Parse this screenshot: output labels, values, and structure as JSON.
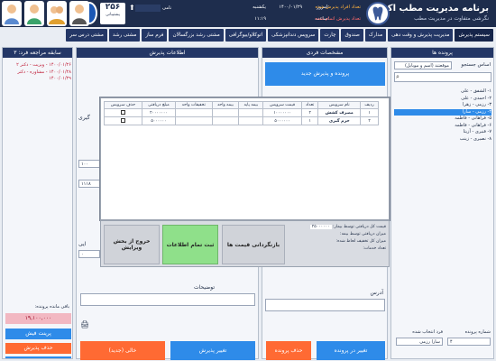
{
  "header": {
    "app_title": "برنامه مدیریت مطب اکسیر",
    "app_subtitle": "نگرشی متفاوت در مدیریت مطب",
    "today_label": "امروز:",
    "today_date": "۱۴۰۰/۰۱/۲۹",
    "weekday": "یکشنبه",
    "time_label": "ساعت:",
    "time_value": "۱۱:۱۹",
    "admitted_label": "تعداد افراد پذیرش شده",
    "admitted_done_label": "تعداد پذیرش اتمام شده",
    "user_label": "نامی",
    "support_number": "۲۵۶",
    "support_label": "پشتیبانی"
  },
  "nav": {
    "items": [
      "سیستم پذیرش",
      "مدیریت پذیرش و وقت دهی",
      "مدارک",
      "صندوق",
      "چارت",
      "سرویس دندانپزشکی",
      "اتوکلاو/بیوگرافی",
      "مشتی رشد بزرگسالان",
      "فرم ساز",
      "مشتی رشد",
      "مشتی درس سر"
    ]
  },
  "cases": {
    "title": "پرونده ها",
    "search_label": "اساس جستجو",
    "search_option": "موقعتند (اسم و موبایل)",
    "tree": [
      "۱- الشفق - علی",
      "۲- احمدی - علی",
      "۳- رزمی - زهرا",
      "۴- رزمی - سارا",
      "۵- فراهانی - فاطمه",
      "۶- فراهانی - فاطمه",
      "۷- قنبری - آزیتا",
      "۸- نصیری - زینب"
    ],
    "selected_index": 3,
    "footer_case_label": "شماره پرونده",
    "footer_person_label": "فرد انتخاب شده",
    "footer_case_value": "۴",
    "footer_person_value": "سارا رزمی"
  },
  "individual": {
    "title": "مشخصات فردی",
    "button_new_admission": "پرونده و پذیرش جدید",
    "address_label": "آدرس"
  },
  "admission": {
    "title": "اطلاعات پذیرش",
    "description_label": "توضیحات",
    "partial_label_1": "گیری",
    "partial_label_2": "ایی",
    "field_a": "۱۰۰",
    "field_b": "۱۱۱۸",
    "field_c": "۰"
  },
  "history": {
    "title": "سابقه مراجعه فرد: ۳",
    "entries": [
      "۱۴۰۰/۰۱/۲۶ - ویزیت - دکتر ۲",
      "۱۴۰۰/۰۱/۲۸ - مشاوره - دکتر",
      "۱۴۰۰/۰۱/۲۹"
    ],
    "remaining_label": "باقی مانده پرونده:",
    "remaining_value": "۱۹,۱۰۰,۰۰۰"
  },
  "table": {
    "headers": [
      "ردیف",
      "نام سرویس",
      "تعداد",
      "قیمت سرویس",
      "بیمه پایه",
      "بیمه واحد",
      "تخفیفات واحد",
      "مبلغ دریافتی",
      "حذف سرویس"
    ],
    "rows": [
      [
        "۱",
        "مصرف کشش",
        "۲",
        "۱۰۰۰۰۰۰۰",
        "",
        "",
        "",
        "۲۰۰۰۰۰۰۰",
        ""
      ],
      [
        "۲",
        "جرم گیری",
        "۱",
        "۵۰۰۰۰۰۰",
        "",
        "",
        "",
        "۵۰۰۰۰۰۰",
        ""
      ]
    ]
  },
  "summary": {
    "total_label": "قیمت کل دریافتی توسط بیمار:",
    "total_value": "۲۵۰۰۰۰۰۰",
    "insurance_label": "میزان دریافتی توسط بیمه:",
    "discount_label": "میزان کل تخفیف لحاظ شده:",
    "count_label": "تعداد خدمات:"
  },
  "modal_buttons": {
    "recalc": "بازنگردانی قیمت ها",
    "save_all": "ثبت تمام اطلاعات",
    "exit": "خروج از بخش ویرایش"
  },
  "bottom_buttons": {
    "change_case": "تغییر در پرونده",
    "delete_case": "حذف پرونده",
    "change_admission": "تغییر پذیرش",
    "empty_new": "خالی (جدید)",
    "print_invoice": "پرینت فیش",
    "delete_admission": "حذف پذیرش",
    "pay": "پرداخت"
  },
  "colors": {
    "navy": "#1e2d4d",
    "tab": "#243766",
    "blue_button": "#2e8be9",
    "orange_button": "#ff6a33",
    "green_button": "#8fe08a"
  }
}
